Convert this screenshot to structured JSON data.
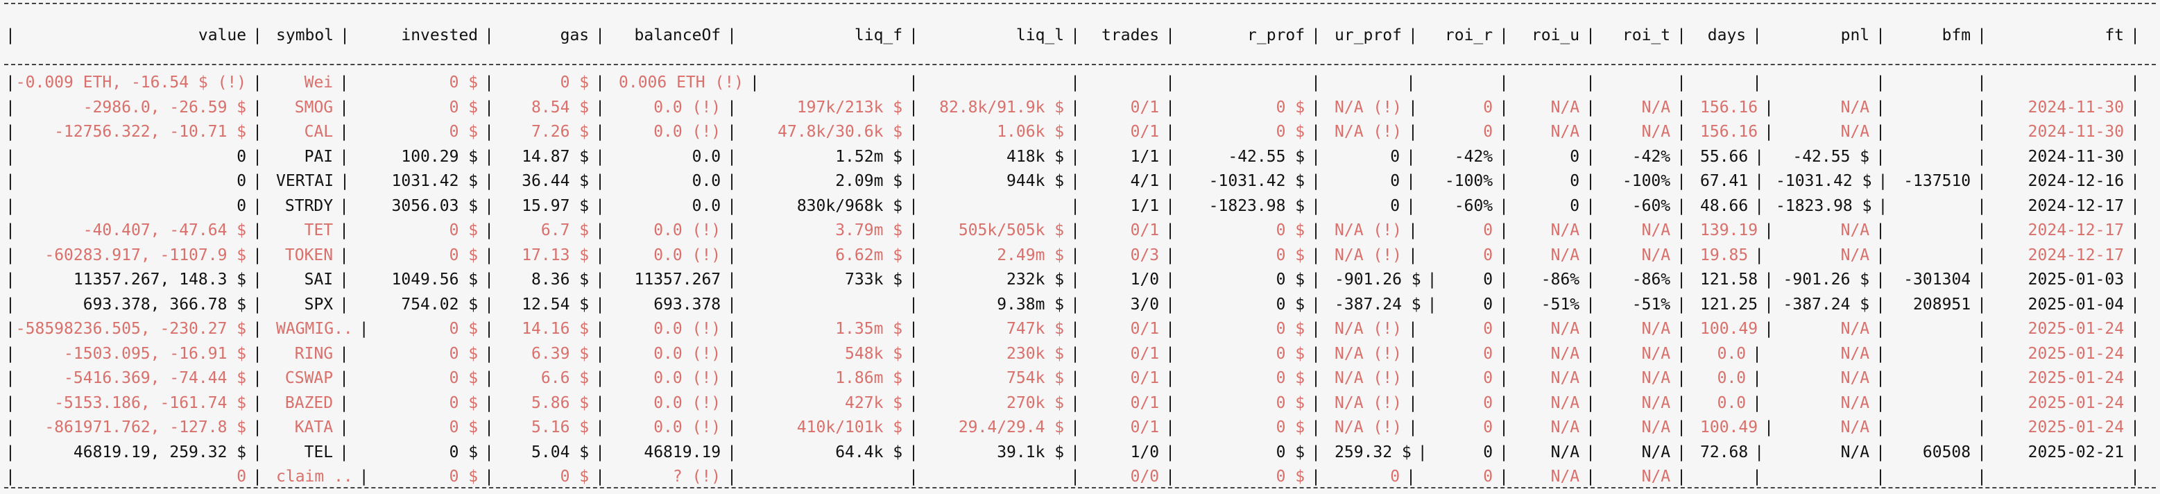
{
  "colors": {
    "background": "#f6f6f6",
    "text": "#111111",
    "highlight": "#d9706b",
    "border": "#444444"
  },
  "columns": [
    "value",
    "symbol",
    "invested",
    "gas",
    "balanceOf",
    "liq_f",
    "liq_l",
    "trades",
    "r_prof",
    "ur_prof",
    "roi_r",
    "roi_u",
    "roi_t",
    "days",
    "pnl",
    "bfm",
    "ft"
  ],
  "rows": [
    {
      "highlight": true,
      "cells": [
        "-0.009 ETH, -16.54 $ (!)",
        "Wei",
        "0 $",
        "0 $",
        "0.006 ETH (!)",
        "",
        "",
        "",
        "",
        "",
        "",
        "",
        "",
        "",
        "",
        "",
        ""
      ]
    },
    {
      "highlight": true,
      "cells": [
        "-2986.0, -26.59 $",
        "SMOG",
        "0 $",
        "8.54 $",
        "0.0 (!)",
        "197k/213k $",
        "82.8k/91.9k $",
        "0/1",
        "0 $",
        "N/A (!)",
        "0",
        "N/A",
        "N/A",
        "156.16",
        "N/A",
        "",
        "2024-11-30"
      ]
    },
    {
      "highlight": true,
      "cells": [
        "-12756.322, -10.71 $",
        "CAL",
        "0 $",
        "7.26 $",
        "0.0 (!)",
        "47.8k/30.6k $",
        "1.06k $",
        "0/1",
        "0 $",
        "N/A (!)",
        "0",
        "N/A",
        "N/A",
        "156.16",
        "N/A",
        "",
        "2024-11-30"
      ]
    },
    {
      "highlight": false,
      "cells": [
        "0",
        "PAI",
        "100.29 $",
        "14.87 $",
        "0.0",
        "1.52m $",
        "418k $",
        "1/1",
        "-42.55 $",
        "0",
        "-42%",
        "0",
        "-42%",
        "55.66",
        "-42.55 $",
        "",
        "2024-11-30"
      ]
    },
    {
      "highlight": false,
      "cells": [
        "0",
        "VERTAI",
        "1031.42 $",
        "36.44 $",
        "0.0",
        "2.09m $",
        "944k $",
        "4/1",
        "-1031.42 $",
        "0",
        "-100%",
        "0",
        "-100%",
        "67.41",
        "-1031.42 $",
        "-137510",
        "2024-12-16"
      ]
    },
    {
      "highlight": false,
      "cells": [
        "0",
        "STRDY",
        "3056.03 $",
        "15.97 $",
        "0.0",
        "830k/968k $",
        "",
        "1/1",
        "-1823.98 $",
        "0",
        "-60%",
        "0",
        "-60%",
        "48.66",
        "-1823.98 $",
        "",
        "2024-12-17"
      ]
    },
    {
      "highlight": true,
      "cells": [
        "-40.407, -47.64 $",
        "TET",
        "0 $",
        "6.7 $",
        "0.0 (!)",
        "3.79m $",
        "505k/505k $",
        "0/1",
        "0 $",
        "N/A (!)",
        "0",
        "N/A",
        "N/A",
        "139.19",
        "N/A",
        "",
        "2024-12-17"
      ]
    },
    {
      "highlight": true,
      "cells": [
        "-60283.917, -1107.9 $",
        "TOKEN",
        "0 $",
        "17.13 $",
        "0.0 (!)",
        "6.62m $",
        "2.49m $",
        "0/3",
        "0 $",
        "N/A (!)",
        "0",
        "N/A",
        "N/A",
        "19.85",
        "N/A",
        "",
        "2024-12-17"
      ]
    },
    {
      "highlight": false,
      "cells": [
        "11357.267, 148.3 $",
        "SAI",
        "1049.56 $",
        "8.36 $",
        "11357.267",
        "733k $",
        "232k $",
        "1/0",
        "0 $",
        "-901.26 $",
        "0",
        "-86%",
        "-86%",
        "121.58",
        "-901.26 $",
        "-301304",
        "2025-01-03"
      ]
    },
    {
      "highlight": false,
      "cells": [
        "693.378, 366.78 $",
        "SPX",
        "754.02 $",
        "12.54 $",
        "693.378",
        "",
        "9.38m $",
        "3/0",
        "0 $",
        "-387.24 $",
        "0",
        "-51%",
        "-51%",
        "121.25",
        "-387.24 $",
        "208951",
        "2025-01-04"
      ]
    },
    {
      "highlight": true,
      "cells": [
        "-58598236.505, -230.27 $",
        "WAGMIG..",
        "0 $",
        "14.16 $",
        "0.0 (!)",
        "1.35m $",
        "747k $",
        "0/1",
        "0 $",
        "N/A (!)",
        "0",
        "N/A",
        "N/A",
        "100.49",
        "N/A",
        "",
        "2025-01-24"
      ]
    },
    {
      "highlight": true,
      "cells": [
        "-1503.095, -16.91 $",
        "RING",
        "0 $",
        "6.39 $",
        "0.0 (!)",
        "548k $",
        "230k $",
        "0/1",
        "0 $",
        "N/A (!)",
        "0",
        "N/A",
        "N/A",
        "0.0",
        "N/A",
        "",
        "2025-01-24"
      ]
    },
    {
      "highlight": true,
      "cells": [
        "-5416.369, -74.44 $",
        "CSWAP",
        "0 $",
        "6.6 $",
        "0.0 (!)",
        "1.86m $",
        "754k $",
        "0/1",
        "0 $",
        "N/A (!)",
        "0",
        "N/A",
        "N/A",
        "0.0",
        "N/A",
        "",
        "2025-01-24"
      ]
    },
    {
      "highlight": true,
      "cells": [
        "-5153.186, -161.74 $",
        "BAZED",
        "0 $",
        "5.86 $",
        "0.0 (!)",
        "427k $",
        "270k $",
        "0/1",
        "0 $",
        "N/A (!)",
        "0",
        "N/A",
        "N/A",
        "0.0",
        "N/A",
        "",
        "2025-01-24"
      ]
    },
    {
      "highlight": true,
      "cells": [
        "-861971.762, -127.8 $",
        "KATA",
        "0 $",
        "5.16 $",
        "0.0 (!)",
        "410k/101k $",
        "29.4/29.4 $",
        "0/1",
        "0 $",
        "N/A (!)",
        "0",
        "N/A",
        "N/A",
        "100.49",
        "N/A",
        "",
        "2025-01-24"
      ]
    },
    {
      "highlight": false,
      "cells": [
        "46819.19, 259.32 $",
        "TEL",
        "0 $",
        "5.04 $",
        "46819.19",
        "64.4k $",
        "39.1k $",
        "1/0",
        "0 $",
        "259.32 $",
        "0",
        "N/A",
        "N/A",
        "72.68",
        "N/A",
        "60508",
        "2025-02-21"
      ]
    },
    {
      "highlight": true,
      "cells": [
        "0",
        "claim ..",
        "0 $",
        "0 $",
        "? (!)",
        "",
        "",
        "0/0",
        "0 $",
        "0",
        "0",
        "N/A",
        "N/A",
        "",
        "",
        "",
        ""
      ]
    }
  ]
}
